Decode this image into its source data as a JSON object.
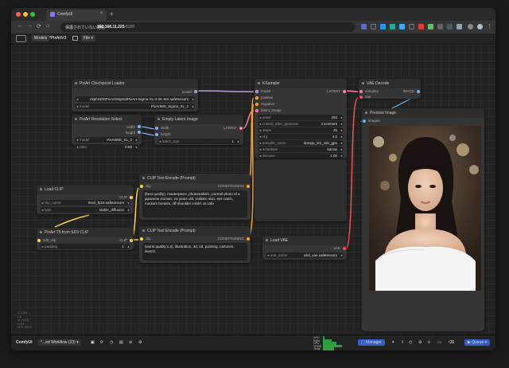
{
  "browser": {
    "tab_title": "ComfyUI",
    "new_tab": "+",
    "url_warning": "保護されていない通信",
    "url_host": "192.168.11.225",
    "url_port": ":8188",
    "nav_back": "←",
    "nav_forward": "→",
    "nav_reload": "⟳",
    "nav_home": "⌂"
  },
  "toolbar": {
    "models": "Models",
    "workflow_name": "*PixArtV3",
    "file": "File"
  },
  "nodes": {
    "checkpoint": {
      "title": "PixArt Checkpoint Loader",
      "out_model": "model",
      "ckpt_value": "ckpt\\SD3\\PixArt\\Sigma\\PixArt-Sigma-XL-2-2K-MS.safetensors",
      "model_name": "model",
      "model_value": "PixArtMS_Sigma_XL_2"
    },
    "resolution": {
      "title": "PixArt Resolution Select",
      "out_width": "width",
      "out_height": "height",
      "model_name": "model",
      "model_value": "PixArtMS_XL_2",
      "ratio_name": "ratio",
      "ratio_value": "0.68"
    },
    "latent": {
      "title": "Empty Latent Image",
      "in_width": "width",
      "in_height": "height",
      "out_latent": "LATENT",
      "batch_name": "batch_size",
      "batch_value": "1"
    },
    "ksampler": {
      "title": "KSampler",
      "in_model": "model",
      "in_positive": "positive",
      "in_negative": "negative",
      "in_latent": "latent_image",
      "out_latent": "LATENT",
      "widgets": [
        {
          "name": "seed",
          "value": "293"
        },
        {
          "name": "control_after_generate",
          "value": "increment"
        },
        {
          "name": "steps",
          "value": "25"
        },
        {
          "name": "cfg",
          "value": "4.0"
        },
        {
          "name": "sampler_name",
          "value": "dpmpp_2m_sde_gpu"
        },
        {
          "name": "scheduler",
          "value": "karras"
        },
        {
          "name": "denoise",
          "value": "1.00"
        }
      ]
    },
    "vae_decode": {
      "title": "VAE Decode",
      "in_samples": "samples",
      "in_vae": "vae",
      "out_image": "IMAGE"
    },
    "preview": {
      "title": "Preview Image",
      "in_images": "images"
    },
    "load_clip": {
      "title": "Load CLIP",
      "out_clip": "CLIP",
      "clip_name": "clip_name",
      "clip_value": "t5xxl_fp16.safetensors",
      "type_name": "type",
      "type_value": "stable_diffusion"
    },
    "t5": {
      "title": "PixArt T5 from SD3 CLIP",
      "in_clip": "sd3_clip",
      "out_clip": "CLIP",
      "padding_name": "padding",
      "padding_value": "1"
    },
    "clip_pos": {
      "title": "CLIP Text Encode (Prompt)",
      "in_clip": "clip",
      "out_cond": "CONDITIONING",
      "text": "(best quality), masterpiece, photorealistic, portrait photo of a japanese woman, 23 years old, realistic skin, eye catch, medium breasts, off-shoulder t-shirt, at cafe"
    },
    "clip_neg": {
      "title": "CLIP Text Encode (Prompt)",
      "in_clip": "clip",
      "out_cond": "CONDITIONING",
      "text": "(worst quality:1.2), illustration, 3d, 2d, painting, cartoons, sketch,"
    },
    "load_vae": {
      "title": "Load VAE",
      "out_vae": "VAE",
      "vae_name": "vae_name",
      "vae_value": "sdxl_vae.safetensors"
    }
  },
  "bottom": {
    "app_name": "ComfyUI",
    "workflow_tab": "*...ed Workflow (23)",
    "manager": "Manager",
    "queue": "Queue",
    "meters": [
      {
        "label": "CPU",
        "value": 0.08
      },
      {
        "label": "RAM",
        "value": 0.35
      },
      {
        "label": "GPU",
        "value": 0.55
      },
      {
        "label": "VRAM",
        "value": 0.8
      },
      {
        "label": "Temp",
        "value": 0.45
      },
      {
        "label": "HDD",
        "value": 0.2
      }
    ]
  },
  "stats": [
    "T: 0.00s",
    "I: 0",
    "N: 11 [11]",
    "V: 23",
    "FPS: 60.00"
  ],
  "colors": {
    "model": "#b39ddb",
    "clip": "#ffd54f",
    "vae": "#ef5350",
    "latent": "#ff80ab",
    "cond": "#ffa726",
    "int": "#7fb2ff",
    "image": "#64b5f6",
    "accent": "#3a7afe"
  }
}
